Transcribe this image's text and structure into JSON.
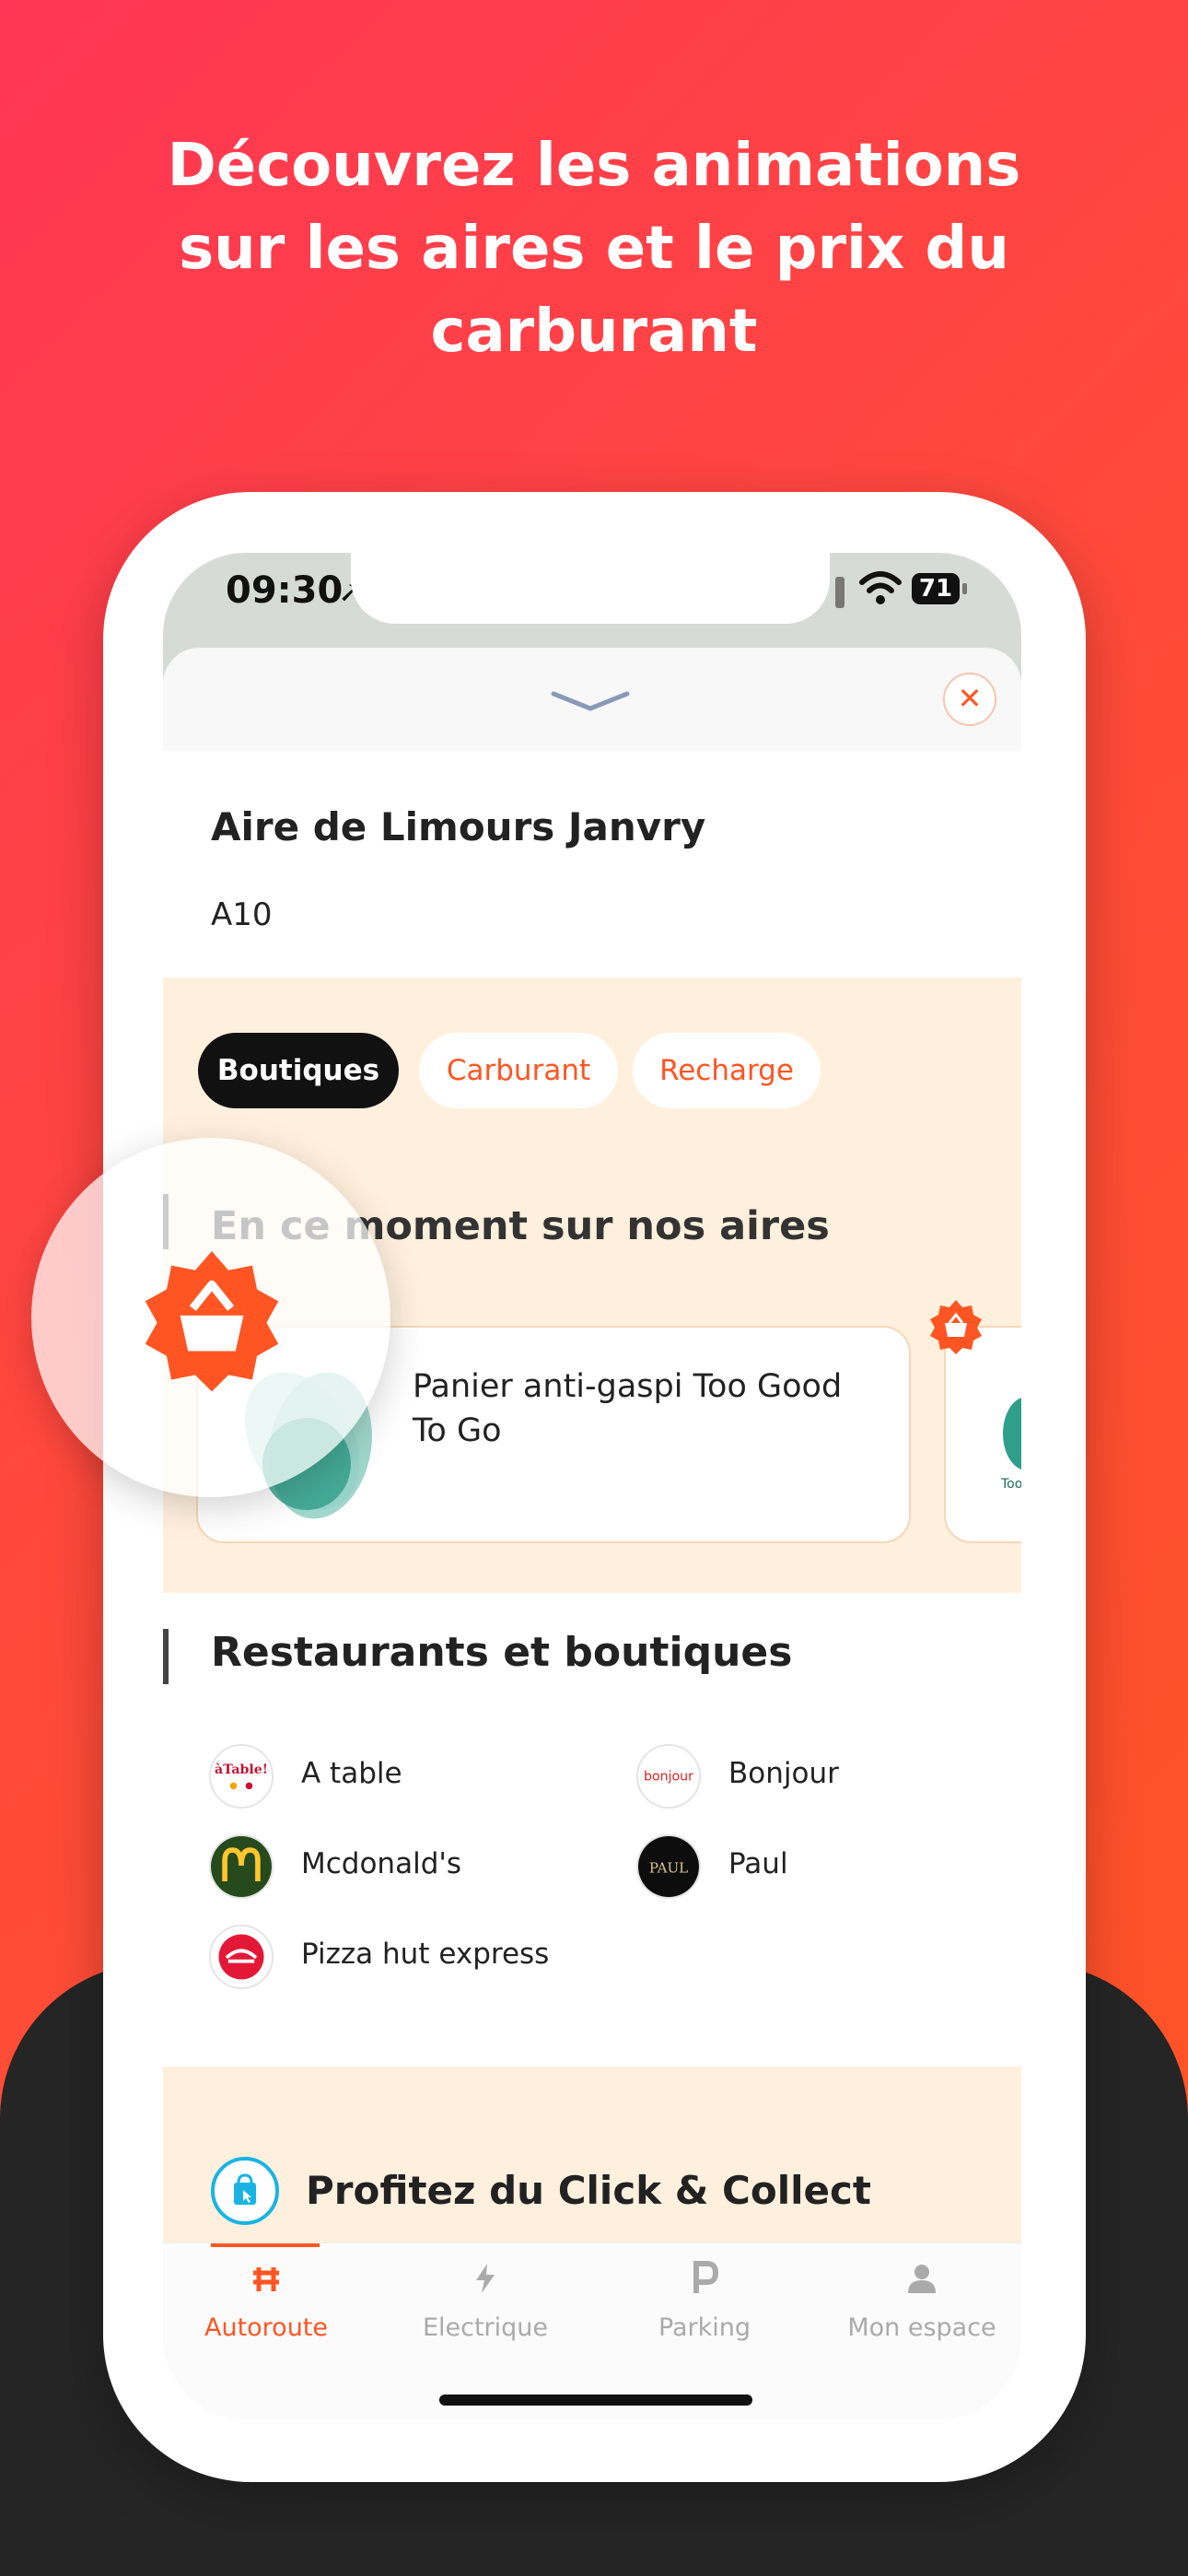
{
  "headline": {
    "line1": "Découvrez les animations",
    "line2": "sur les aires et le prix du",
    "line3": "carburant"
  },
  "status_bar": {
    "time": "09:30",
    "battery": "71"
  },
  "sheet": {
    "aire_name": "Aire de Limours Janvry",
    "road": "A10"
  },
  "filters": [
    "Boutiques",
    "Carburant",
    "Recharge"
  ],
  "promo": {
    "title": "En ce moment sur nos aires",
    "card_text": "Panier anti-gaspi Too Good To Go",
    "card2_text": "Too"
  },
  "restaurants": {
    "title": "Restaurants et boutiques",
    "items": [
      "A table",
      "Bonjour",
      "Mcdonald's",
      "Paul",
      "Pizza hut express"
    ]
  },
  "click_collect": {
    "title": "Profitez du Click & Collect"
  },
  "tabbar": {
    "items": [
      "Autoroute",
      "Electrique",
      "Parking",
      "Mon espace"
    ]
  },
  "colors": {
    "accent": "#ff5522",
    "background_gradient_start": "#ff3655",
    "dark": "#252525",
    "promo_bg": "#fff0dd"
  },
  "icons": [
    "close-icon",
    "chevron-down-icon",
    "basket-badge-icon",
    "highway-icon",
    "lightning-icon",
    "parking-icon",
    "person-icon"
  ]
}
